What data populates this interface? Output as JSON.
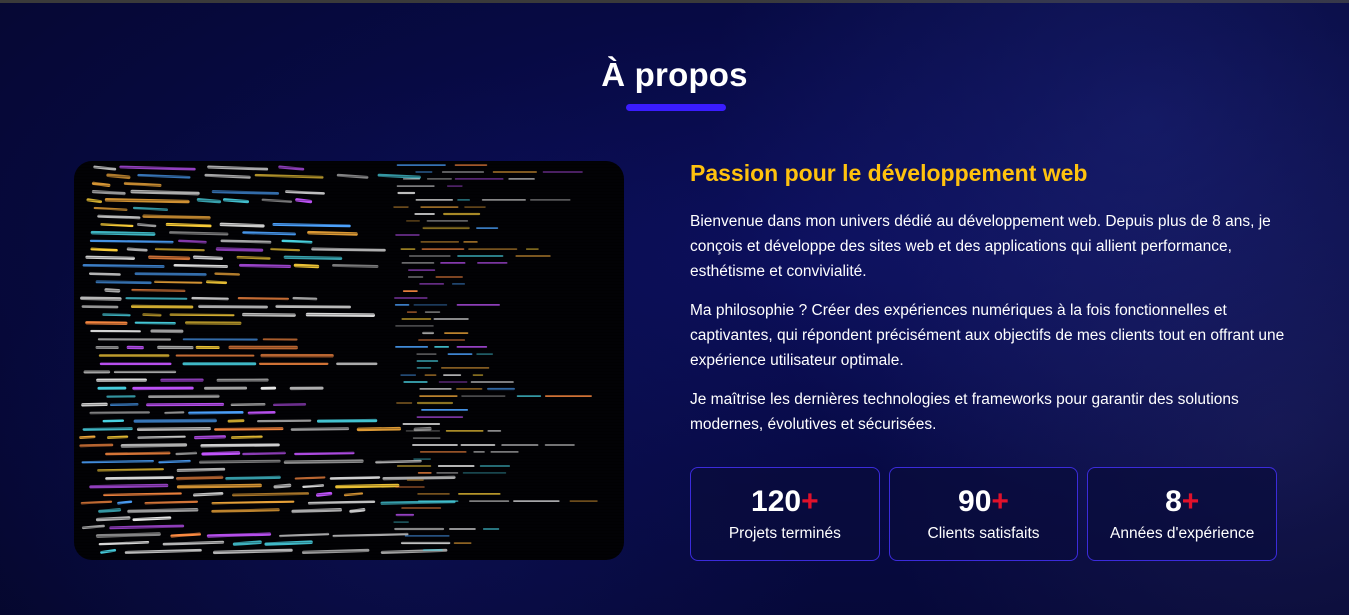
{
  "section": {
    "title": "À propos"
  },
  "about": {
    "subtitle": "Passion pour le développement web",
    "paragraphs": [
      "Bienvenue dans mon univers dédié au développement web. Depuis plus de 8 ans, je conçois et développe des sites web et des applications qui allient performance, esthétisme et convivialité.",
      "Ma philosophie ? Créer des expériences numériques à la fois fonctionnelles et captivantes, qui répondent précisément aux objectifs de mes clients tout en offrant une expérience utilisateur optimale.",
      "Je maîtrise les dernières technologies et frameworks pour garantir des solutions modernes, évolutives et sécurisées."
    ],
    "image_icon": "code-screen-image"
  },
  "stats": [
    {
      "value": "120",
      "suffix": "+",
      "label": "Projets terminés"
    },
    {
      "value": "90",
      "suffix": "+",
      "label": "Clients satisfaits"
    },
    {
      "value": "8",
      "suffix": "+",
      "label": "Années d'expérience"
    }
  ],
  "colors": {
    "accent_yellow": "#ffc20e",
    "accent_blue": "#3a1cff",
    "accent_red": "#e0112b",
    "background": "#070a44"
  }
}
